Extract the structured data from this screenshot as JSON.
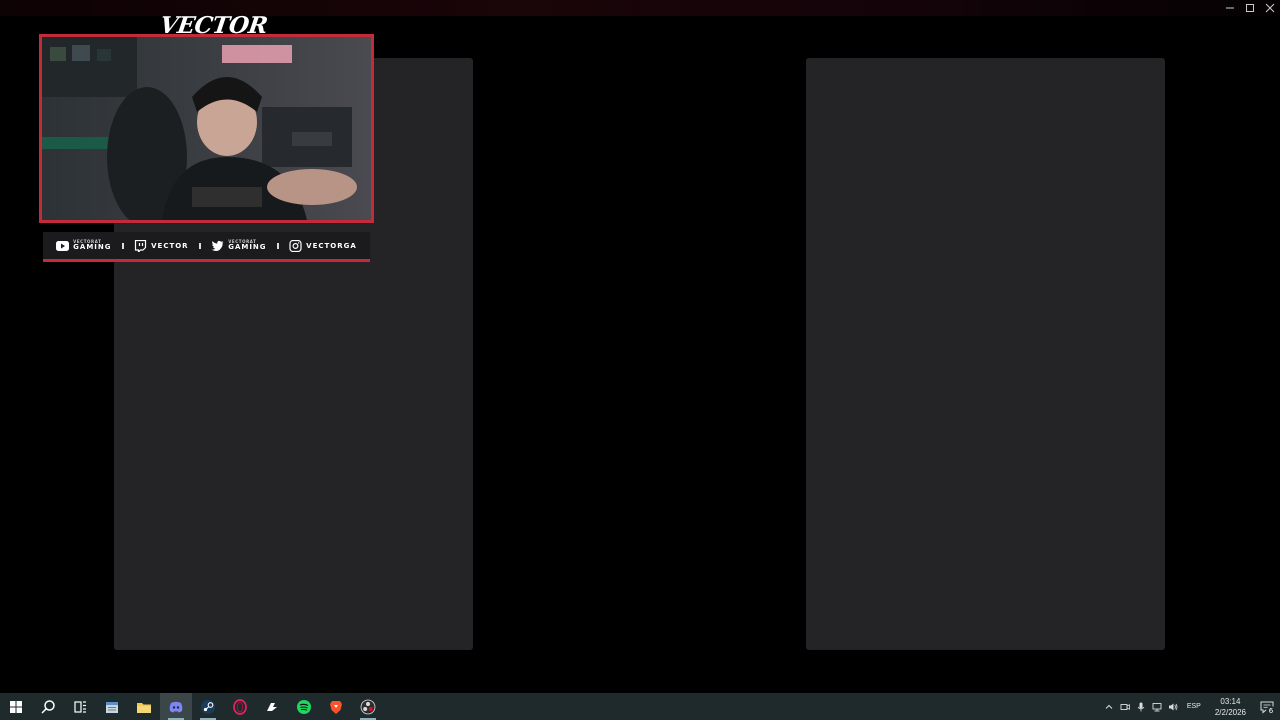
{
  "overlay": {
    "title": "VECTOR",
    "accent": "#c42b3a",
    "socials": [
      {
        "icon": "youtube-icon",
        "small": "VECTORAT",
        "big": "GAMING"
      },
      {
        "icon": "twitch-icon",
        "text": "VECTOR"
      },
      {
        "icon": "twitter-icon",
        "small": "VECTORAT",
        "big": "GAMING"
      },
      {
        "icon": "instagram-icon",
        "text": "VECTORGA"
      }
    ]
  },
  "taskbar": {
    "apps": [
      "start-icon",
      "search-icon",
      "task-view-icon",
      "notepad-icon",
      "file-explorer-icon",
      "discord-icon",
      "steam-icon",
      "opera-gx-icon",
      "rockstar-icon",
      "spotify-icon",
      "brave-icon",
      "obs-icon"
    ],
    "language": "ESP",
    "time": "03:14",
    "date": "2/2/2026",
    "notification_count": "6"
  }
}
